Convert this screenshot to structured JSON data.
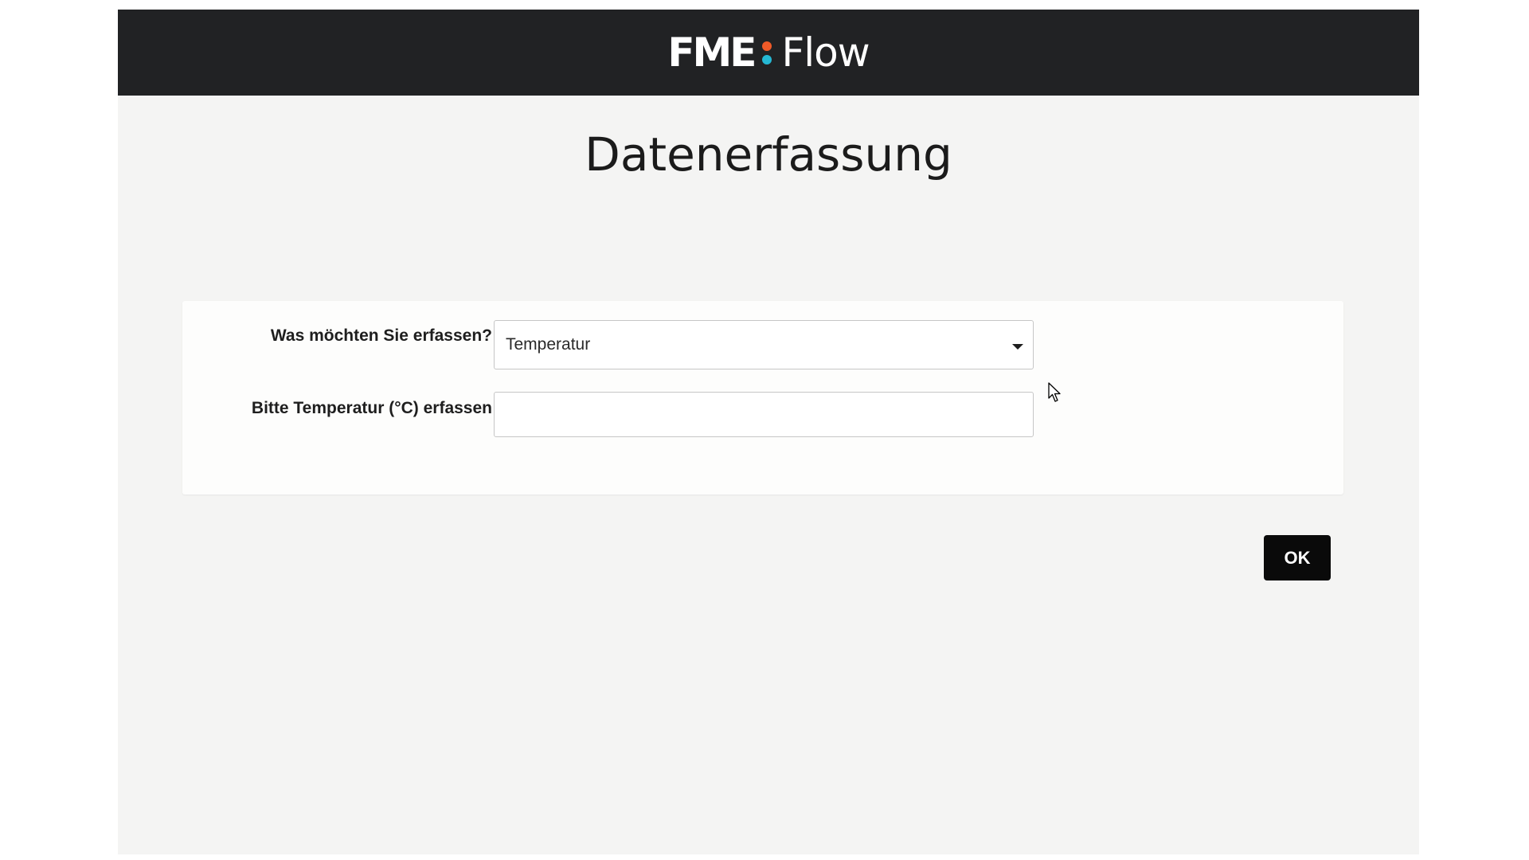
{
  "header": {
    "logo_part1": "FME",
    "logo_part2": "Flow",
    "logo_dot_colors": [
      "#f05a28",
      "#25b8d4"
    ]
  },
  "page": {
    "title": "Datenerfassung"
  },
  "form": {
    "type_label": "Was möchten Sie erfassen?",
    "type_value": "Temperatur",
    "temp_label": "Bitte Temperatur (°C) erfassen",
    "temp_value": ""
  },
  "actions": {
    "ok_label": "OK"
  },
  "colors": {
    "header_bg": "#212224",
    "page_bg": "#f4f4f3",
    "button_bg": "#0a0a0a"
  }
}
